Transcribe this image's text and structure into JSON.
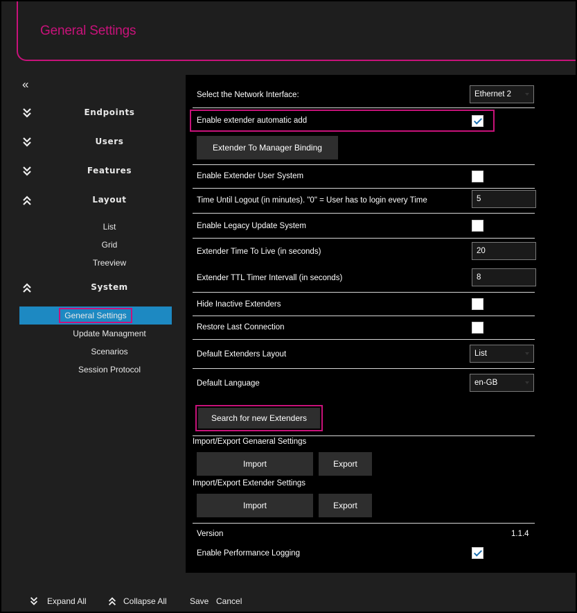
{
  "header": {
    "title": "General Settings"
  },
  "sidebar": {
    "collapse_glyph": "«",
    "sections": [
      {
        "label": "Endpoints",
        "expanded": false
      },
      {
        "label": "Users",
        "expanded": false
      },
      {
        "label": "Features",
        "expanded": false
      },
      {
        "label": "Layout",
        "expanded": true
      },
      {
        "label": "System",
        "expanded": true
      }
    ],
    "layout_items": [
      "List",
      "Grid",
      "Treeview"
    ],
    "system_items": [
      "General Settings",
      "Update Managment",
      "Scenarios",
      "Session Protocol"
    ],
    "active_item": "General Settings"
  },
  "settings": {
    "network_interface_label": "Select the Network Interface:",
    "network_interface_value": "Ethernet 2",
    "auto_add_label": "Enable extender automatic add",
    "auto_add_checked": true,
    "binding_button": "Extender To Manager Binding",
    "user_system_label": "Enable Extender User System",
    "user_system_checked": false,
    "logout_label": "Time Until Logout (in minutes). \"0\" = User has to login every Time",
    "logout_value": "5",
    "legacy_label": "Enable Legacy Update System",
    "legacy_checked": false,
    "ttl_label": "Extender Time To Live (in seconds)",
    "ttl_value": "20",
    "ttl_interval_label": "Extender TTL Timer Intervall (in seconds)",
    "ttl_interval_value": "8",
    "hide_inactive_label": "Hide Inactive Extenders",
    "hide_inactive_checked": false,
    "restore_label": "Restore Last Connection",
    "restore_checked": false,
    "layout_label": "Default Extenders Layout",
    "layout_value": "List",
    "language_label": "Default Language",
    "language_value": "en-GB",
    "search_button": "Search for new Extenders",
    "general_ie_title": "Import/Export Genaeral Settings",
    "extender_ie_title": "Import/Export Extender Settings",
    "import_label": "Import",
    "export_label": "Export",
    "version_label": "Version",
    "version_value": "1.1.4",
    "perf_logging_label": "Enable Performance Logging",
    "perf_logging_checked": true
  },
  "bottom_bar": {
    "expand_all": "Expand All",
    "collapse_all": "Collapse All",
    "save": "Save",
    "cancel": "Cancel"
  },
  "colors": {
    "accent": "#c8127a",
    "active_bg": "#1d89c2",
    "panel_bg": "#000000",
    "frame_bg": "#1f1f1f"
  }
}
